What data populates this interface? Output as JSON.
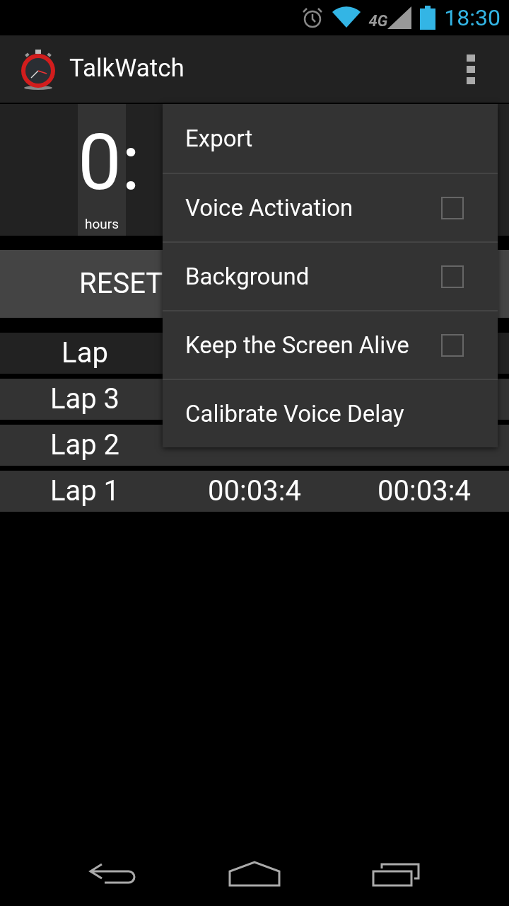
{
  "status_bar": {
    "time": "18:30",
    "network": "4G"
  },
  "app_bar": {
    "title": "TalkWatch"
  },
  "timer": {
    "display": "0:",
    "unit": "hours"
  },
  "controls": {
    "reset": "RESET"
  },
  "laps": {
    "header": "Lap",
    "rows": [
      {
        "lap": "Lap 3"
      },
      {
        "lap": "Lap 2"
      },
      {
        "lap": "Lap 1",
        "lap_time": "00:03:4",
        "total": "00:03:4"
      }
    ]
  },
  "menu": [
    {
      "kind": "action",
      "label": "Export"
    },
    {
      "kind": "checkbox",
      "label": "Voice Activation",
      "checked": false
    },
    {
      "kind": "checkbox",
      "label": "Background",
      "checked": false
    },
    {
      "kind": "checkbox",
      "label": "Keep the Screen Alive",
      "checked": false
    },
    {
      "kind": "action",
      "label": "Calibrate Voice Delay"
    }
  ]
}
